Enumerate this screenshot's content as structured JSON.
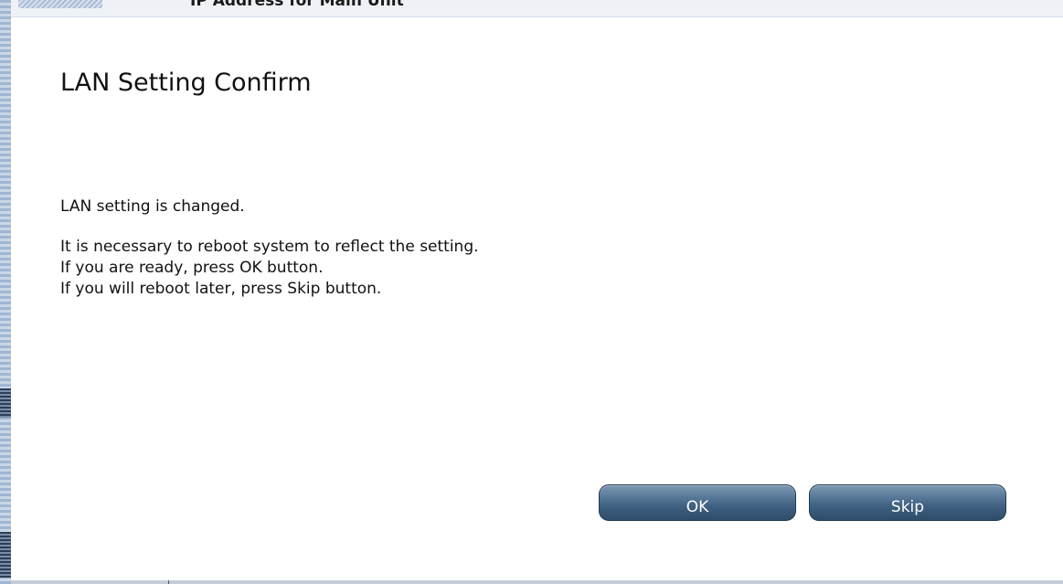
{
  "background": {
    "partial_heading": "IP Address for Main Unit"
  },
  "dialog": {
    "title": "LAN Setting Confirm",
    "message_lines": [
      "LAN setting is changed.",
      "It is necessary to reboot system to reflect the setting.",
      "If you are ready, press OK button.",
      "If you will reboot later, press Skip button."
    ],
    "buttons": {
      "ok_label": "OK",
      "skip_label": "Skip"
    }
  },
  "colors": {
    "button_gradient_top": "#7d98b2",
    "button_gradient_bottom": "#2e4d6b",
    "dialog_background": "#ffffff",
    "text": "#111111"
  }
}
